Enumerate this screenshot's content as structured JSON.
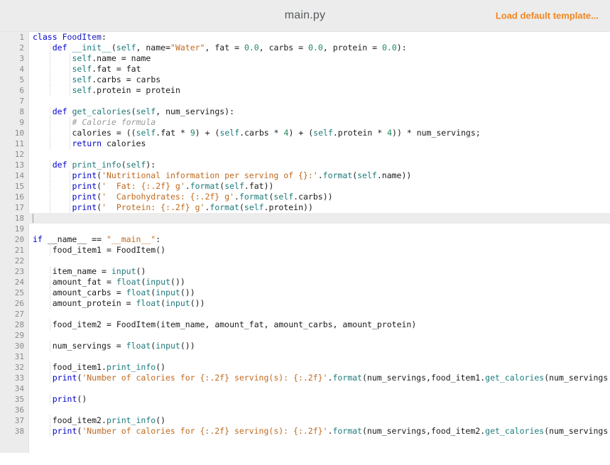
{
  "header": {
    "file_title": "main.py",
    "load_template_label": "Load default template...",
    "accent_color": "#f3871f",
    "background_color": "#ececec"
  },
  "editor": {
    "language": "python",
    "active_line": 18,
    "total_lines": 38,
    "gutter_background": "#ececec",
    "active_line_background": "#ececec",
    "syntax_colors": {
      "keyword": "#0000cd",
      "function": "#1d7a7a",
      "builtin": "#1d7a7a",
      "string": "#bf6a1e",
      "number": "#1d8a5a",
      "comment": "#9a9a9a",
      "plain": "#1a1a1a"
    },
    "lines": [
      {
        "n": 1,
        "text": "class FoodItem:"
      },
      {
        "n": 2,
        "text": "    def __init__(self, name=\"Water\", fat = 0.0, carbs = 0.0, protein = 0.0):"
      },
      {
        "n": 3,
        "text": "        self.name = name"
      },
      {
        "n": 4,
        "text": "        self.fat = fat"
      },
      {
        "n": 5,
        "text": "        self.carbs = carbs"
      },
      {
        "n": 6,
        "text": "        self.protein = protein"
      },
      {
        "n": 7,
        "text": ""
      },
      {
        "n": 8,
        "text": "    def get_calories(self, num_servings):"
      },
      {
        "n": 9,
        "text": "        # Calorie formula"
      },
      {
        "n": 10,
        "text": "        calories = ((self.fat * 9) + (self.carbs * 4) + (self.protein * 4)) * num_servings;"
      },
      {
        "n": 11,
        "text": "        return calories"
      },
      {
        "n": 12,
        "text": ""
      },
      {
        "n": 13,
        "text": "    def print_info(self):"
      },
      {
        "n": 14,
        "text": "        print('Nutritional information per serving of {}:'.format(self.name))"
      },
      {
        "n": 15,
        "text": "        print('  Fat: {:.2f} g'.format(self.fat))"
      },
      {
        "n": 16,
        "text": "        print('  Carbohydrates: {:.2f} g'.format(self.carbs))"
      },
      {
        "n": 17,
        "text": "        print('  Protein: {:.2f} g'.format(self.protein))"
      },
      {
        "n": 18,
        "text": ""
      },
      {
        "n": 19,
        "text": ""
      },
      {
        "n": 20,
        "text": "if __name__ == \"__main__\":"
      },
      {
        "n": 21,
        "text": "    food_item1 = FoodItem()"
      },
      {
        "n": 22,
        "text": ""
      },
      {
        "n": 23,
        "text": "    item_name = input()"
      },
      {
        "n": 24,
        "text": "    amount_fat = float(input())"
      },
      {
        "n": 25,
        "text": "    amount_carbs = float(input())"
      },
      {
        "n": 26,
        "text": "    amount_protein = float(input())"
      },
      {
        "n": 27,
        "text": ""
      },
      {
        "n": 28,
        "text": "    food_item2 = FoodItem(item_name, amount_fat, amount_carbs, amount_protein)"
      },
      {
        "n": 29,
        "text": ""
      },
      {
        "n": 30,
        "text": "    num_servings = float(input())"
      },
      {
        "n": 31,
        "text": ""
      },
      {
        "n": 32,
        "text": "    food_item1.print_info()"
      },
      {
        "n": 33,
        "text": "    print('Number of calories for {:.2f} serving(s): {:.2f}'.format(num_servings,food_item1.get_calories(num_servings"
      },
      {
        "n": 34,
        "text": ""
      },
      {
        "n": 35,
        "text": "    print()"
      },
      {
        "n": 36,
        "text": ""
      },
      {
        "n": 37,
        "text": "    food_item2.print_info()"
      },
      {
        "n": 38,
        "text": "    print('Number of calories for {:.2f} serving(s): {:.2f}'.format(num_servings,food_item2.get_calories(num_servings"
      }
    ]
  }
}
